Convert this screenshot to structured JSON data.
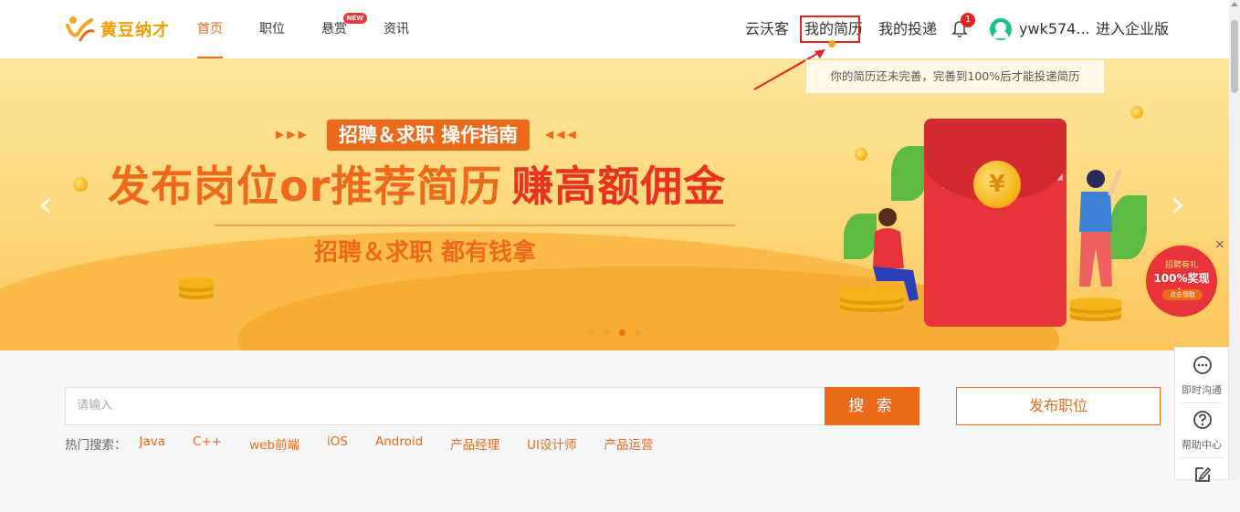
{
  "brand": {
    "name": "黄豆纳才",
    "colors": {
      "accent": "#ee6a1b",
      "highlight": "#e02424",
      "logo": "#f4a000"
    }
  },
  "nav": [
    {
      "label": "首页",
      "active": true
    },
    {
      "label": "职位"
    },
    {
      "label": "悬赏",
      "badge": "NEW"
    },
    {
      "label": "资讯"
    }
  ],
  "right_nav": {
    "yunwoke": "云沃客",
    "my_resume": "我的简历",
    "my_applications": "我的投递",
    "notifications_count": "1",
    "username": "ywk574...",
    "enterprise": "进入企业版"
  },
  "tooltip": "你的简历还未完善，完善到100%后才能投递简历",
  "banner": {
    "tag": "招聘＆求职 操作指南",
    "title_main": "发布岗位or推荐简历",
    "title_highlight": "赚高额佣金",
    "subtitle": "招聘＆求职 都有钱拿",
    "coin_symbol": "¥",
    "prev": "‹",
    "next": "›",
    "slides": 4,
    "current_slide": 3
  },
  "promo": {
    "line1": "招聘有礼",
    "line2": "100%奖现金!",
    "button": "点击领取",
    "close": "×"
  },
  "search": {
    "placeholder": "请输入",
    "button": "搜 索",
    "post_job": "发布职位",
    "hot_label": "热门搜索：",
    "hot_terms": [
      "Java",
      "C++",
      "web前端",
      "iOS",
      "Android",
      "产品经理",
      "UI设计师",
      "产品运营"
    ]
  },
  "side_tools": [
    {
      "label": "即时沟通",
      "icon": "chat-icon"
    },
    {
      "label": "帮助中心",
      "icon": "help-icon"
    },
    {
      "label": "",
      "icon": "edit-icon"
    }
  ]
}
